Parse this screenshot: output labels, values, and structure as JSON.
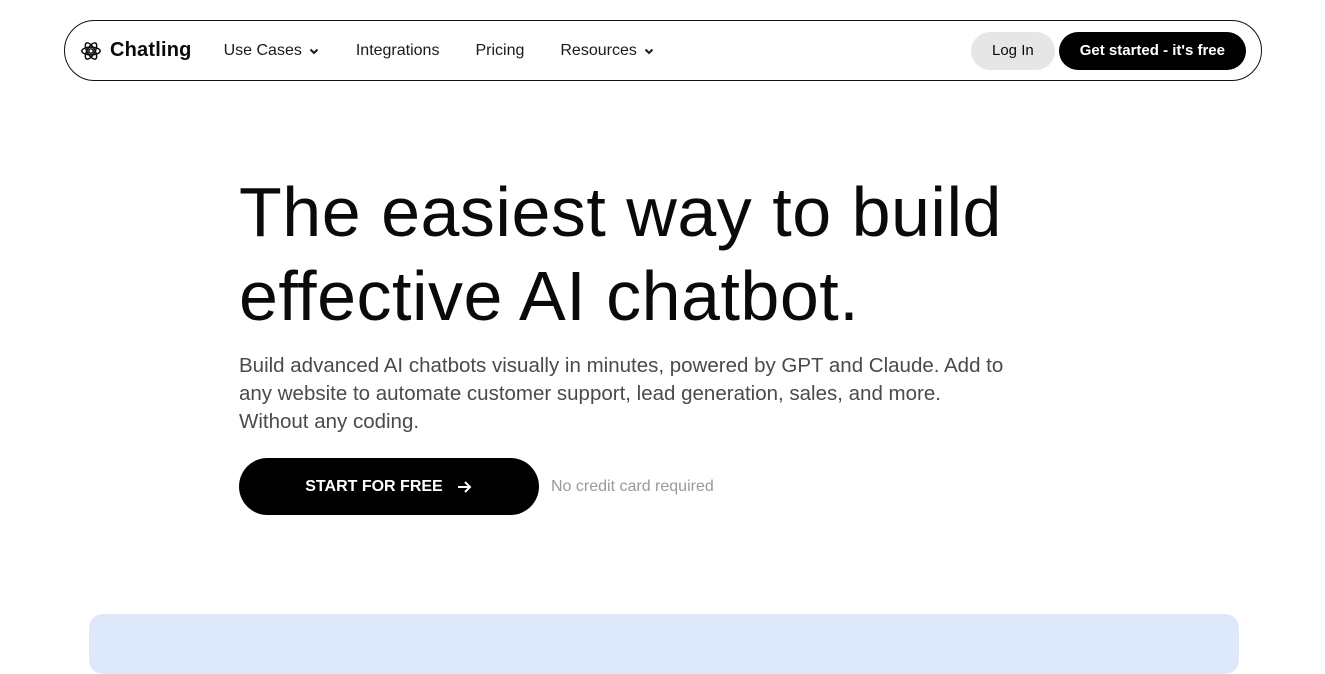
{
  "brand": {
    "name": "Chatling",
    "icon": "atom-logo-icon"
  },
  "nav": {
    "items": [
      {
        "label": "Use Cases",
        "has_dropdown": true
      },
      {
        "label": "Integrations",
        "has_dropdown": false
      },
      {
        "label": "Pricing",
        "has_dropdown": false
      },
      {
        "label": "Resources",
        "has_dropdown": true
      }
    ],
    "login_label": "Log In",
    "get_started_label": "Get started - it's free"
  },
  "hero": {
    "title_lines": [
      "The easiest way to build",
      "effective AI chatbot."
    ],
    "subtitle_lines": [
      "Build advanced AI chatbots visually in minutes, powered by GPT and Claude. Add to",
      "any website to automate customer support, lead generation, sales, and more.",
      "Without any coding."
    ],
    "cta_label": "START FOR FREE",
    "cta_icon": "arrow-right-icon",
    "cta_note": "No credit card required"
  },
  "colors": {
    "primary": "#000000",
    "login_bg": "#e6e6e6",
    "panel_bg": "#dde9fb",
    "note_text": "#9a9a9a"
  }
}
